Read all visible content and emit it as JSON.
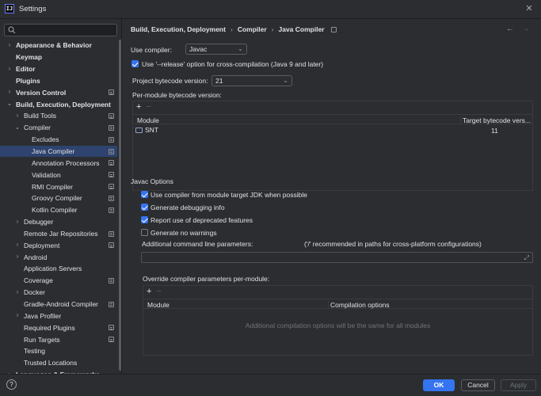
{
  "window": {
    "title": "Settings",
    "app_icon_text": "IJ"
  },
  "sidebar": {
    "search_placeholder": "",
    "items": [
      {
        "label": "Appearance & Behavior",
        "level": 0,
        "chevron": "right",
        "bold": true,
        "doc": false,
        "selected": false
      },
      {
        "label": "Keymap",
        "level": 0,
        "chevron": "",
        "bold": true,
        "doc": false,
        "selected": false
      },
      {
        "label": "Editor",
        "level": 0,
        "chevron": "right",
        "bold": true,
        "doc": false,
        "selected": false
      },
      {
        "label": "Plugins",
        "level": 0,
        "chevron": "",
        "bold": true,
        "doc": false,
        "selected": false
      },
      {
        "label": "Version Control",
        "level": 0,
        "chevron": "right",
        "bold": true,
        "doc": true,
        "selected": false
      },
      {
        "label": "Build, Execution, Deployment",
        "level": 0,
        "chevron": "down",
        "bold": true,
        "doc": false,
        "selected": false
      },
      {
        "label": "Build Tools",
        "level": 1,
        "chevron": "right",
        "bold": false,
        "doc": true,
        "selected": false
      },
      {
        "label": "Compiler",
        "level": 1,
        "chevron": "down",
        "bold": false,
        "doc": true,
        "selected": false
      },
      {
        "label": "Excludes",
        "level": 2,
        "chevron": "",
        "bold": false,
        "doc": true,
        "selected": false
      },
      {
        "label": "Java Compiler",
        "level": 2,
        "chevron": "",
        "bold": false,
        "doc": true,
        "selected": true
      },
      {
        "label": "Annotation Processors",
        "level": 2,
        "chevron": "",
        "bold": false,
        "doc": true,
        "selected": false
      },
      {
        "label": "Validation",
        "level": 2,
        "chevron": "",
        "bold": false,
        "doc": true,
        "selected": false
      },
      {
        "label": "RMI Compiler",
        "level": 2,
        "chevron": "",
        "bold": false,
        "doc": true,
        "selected": false
      },
      {
        "label": "Groovy Compiler",
        "level": 2,
        "chevron": "",
        "bold": false,
        "doc": true,
        "selected": false
      },
      {
        "label": "Kotlin Compiler",
        "level": 2,
        "chevron": "",
        "bold": false,
        "doc": true,
        "selected": false
      },
      {
        "label": "Debugger",
        "level": 1,
        "chevron": "right",
        "bold": false,
        "doc": false,
        "selected": false
      },
      {
        "label": "Remote Jar Repositories",
        "level": 1,
        "chevron": "",
        "bold": false,
        "doc": true,
        "selected": false
      },
      {
        "label": "Deployment",
        "level": 1,
        "chevron": "right",
        "bold": false,
        "doc": true,
        "selected": false
      },
      {
        "label": "Android",
        "level": 1,
        "chevron": "right",
        "bold": false,
        "doc": false,
        "selected": false
      },
      {
        "label": "Application Servers",
        "level": 1,
        "chevron": "",
        "bold": false,
        "doc": false,
        "selected": false
      },
      {
        "label": "Coverage",
        "level": 1,
        "chevron": "",
        "bold": false,
        "doc": true,
        "selected": false
      },
      {
        "label": "Docker",
        "level": 1,
        "chevron": "right",
        "bold": false,
        "doc": false,
        "selected": false
      },
      {
        "label": "Gradle-Android Compiler",
        "level": 1,
        "chevron": "",
        "bold": false,
        "doc": true,
        "selected": false
      },
      {
        "label": "Java Profiler",
        "level": 1,
        "chevron": "right",
        "bold": false,
        "doc": false,
        "selected": false
      },
      {
        "label": "Required Plugins",
        "level": 1,
        "chevron": "",
        "bold": false,
        "doc": true,
        "selected": false
      },
      {
        "label": "Run Targets",
        "level": 1,
        "chevron": "",
        "bold": false,
        "doc": true,
        "selected": false
      },
      {
        "label": "Testing",
        "level": 1,
        "chevron": "",
        "bold": false,
        "doc": false,
        "selected": false
      },
      {
        "label": "Trusted Locations",
        "level": 1,
        "chevron": "",
        "bold": false,
        "doc": false,
        "selected": false
      },
      {
        "label": "Languages & Frameworks",
        "level": 0,
        "chevron": "right",
        "bold": true,
        "doc": false,
        "selected": false
      }
    ]
  },
  "breadcrumb": [
    "Build, Execution, Deployment",
    "Compiler",
    "Java Compiler"
  ],
  "compiler": {
    "use_compiler_label": "Use compiler:",
    "use_compiler_value": "Javac",
    "release_option_label": "Use '--release' option for cross-compilation (Java 9 and later)",
    "release_option_checked": true,
    "bytecode_label": "Project bytecode version:",
    "bytecode_value": "21",
    "per_module_label": "Per-module bytecode version:",
    "module_table": {
      "columns": [
        "Module",
        "Target bytecode vers..."
      ],
      "rows": [
        {
          "module": "SNT",
          "target": "11"
        }
      ]
    }
  },
  "javac": {
    "section_title": "Javac Options",
    "options": [
      {
        "label": "Use compiler from module target JDK when possible",
        "checked": true
      },
      {
        "label": "Generate debugging info",
        "checked": true
      },
      {
        "label": "Report use of deprecated features",
        "checked": true
      },
      {
        "label": "Generate no warnings",
        "checked": false
      }
    ],
    "additional_params_label": "Additional command line parameters:",
    "additional_params_hint": "('/' recommended in paths for cross-platform configurations)",
    "additional_params_value": "",
    "override_label": "Override compiler parameters per-module:",
    "override_table": {
      "columns": [
        "Module",
        "Compilation options"
      ],
      "empty_text": "Additional compilation options will be the same for all modules"
    }
  },
  "footer": {
    "help": "?",
    "ok": "OK",
    "cancel": "Cancel",
    "apply": "Apply"
  }
}
